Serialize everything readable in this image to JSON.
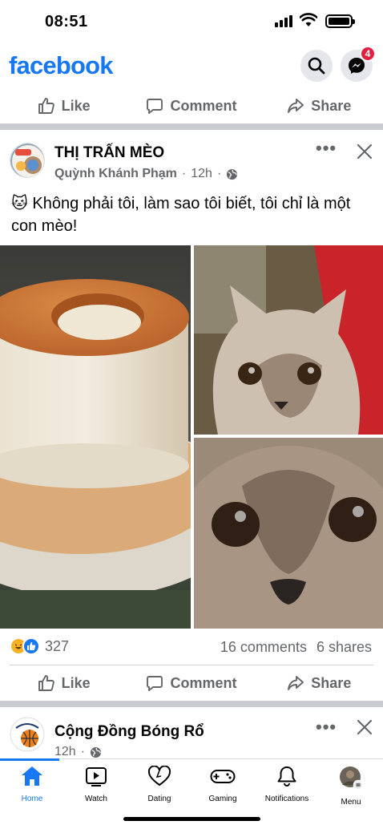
{
  "status_bar": {
    "time": "08:51"
  },
  "header": {
    "logo": "facebook",
    "messenger_badge": "4"
  },
  "top_actions": {
    "like": "Like",
    "comment": "Comment",
    "share": "Share"
  },
  "post": {
    "page_name": "THỊ TRẤN MÈO",
    "author": "Quỳnh Khánh Phạm",
    "time": "12h",
    "text": "🐱 Không phải tôi, làm sao tôi biết, tôi chỉ là một con mèo!",
    "reaction_count": "327",
    "comments": "16 comments",
    "shares": "6 shares",
    "actions": {
      "like": "Like",
      "comment": "Comment",
      "share": "Share"
    }
  },
  "next_post": {
    "page_name": "Cộng Đồng Bóng Rổ",
    "time": "12h"
  },
  "tabbar": {
    "items": [
      {
        "label": "Home",
        "icon": "home-icon"
      },
      {
        "label": "Watch",
        "icon": "watch-icon"
      },
      {
        "label": "Dating",
        "icon": "heart-icon"
      },
      {
        "label": "Gaming",
        "icon": "gamepad-icon"
      },
      {
        "label": "Notifications",
        "icon": "bell-icon"
      },
      {
        "label": "Menu",
        "icon": "avatar-menu-icon"
      }
    ]
  },
  "colors": {
    "brand": "#1877f2",
    "secondary_text": "#65676b",
    "badge": "#e41e3f"
  }
}
